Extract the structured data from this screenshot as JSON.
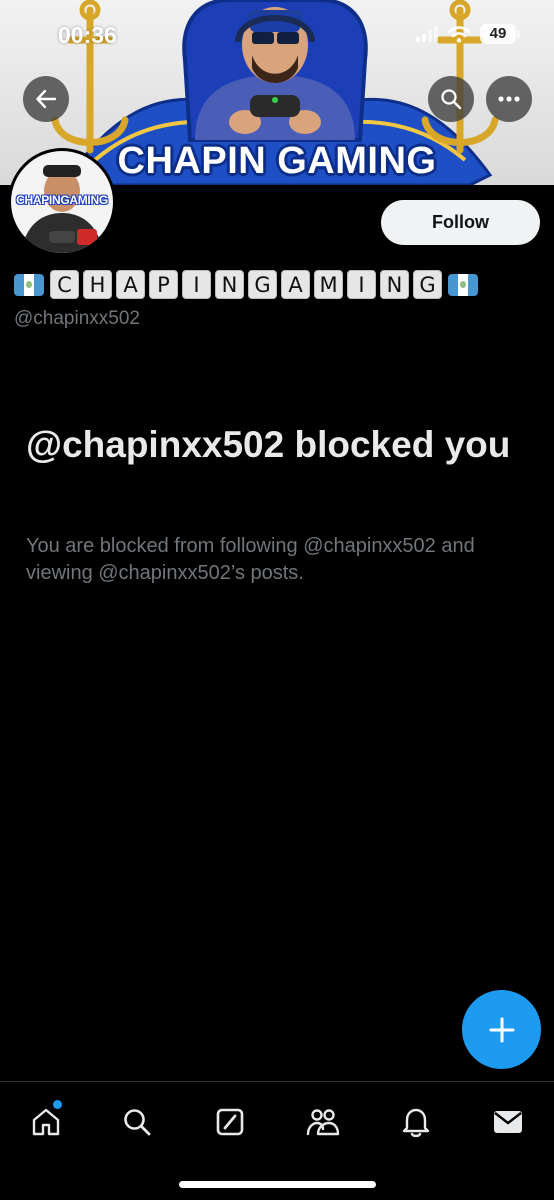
{
  "status_bar": {
    "time": "00:36",
    "battery": "49"
  },
  "banner": {
    "title": "CHAPIN GAMING"
  },
  "avatar": {
    "caption": "CHAPINGAMING"
  },
  "profile": {
    "follow_label": "Follow",
    "name_letters": [
      "C",
      "H",
      "A",
      "P",
      "I",
      "N",
      "G",
      "A",
      "M",
      "I",
      "N",
      "G"
    ],
    "handle": "@chapinxx502"
  },
  "blocked": {
    "title": "@chapinxx502 blocked you",
    "description": "You are blocked from following @chapinxx502 and viewing @chapinxx502’s posts."
  },
  "nav": {
    "items": [
      "home-icon",
      "search-icon",
      "grok-icon",
      "communities-icon",
      "notifications-icon",
      "messages-icon"
    ],
    "home_has_notification": true
  },
  "colors": {
    "accent": "#1d9bf0",
    "background": "#000000",
    "secondary_text": "#71767b",
    "primary_text": "#e7e9ea"
  }
}
